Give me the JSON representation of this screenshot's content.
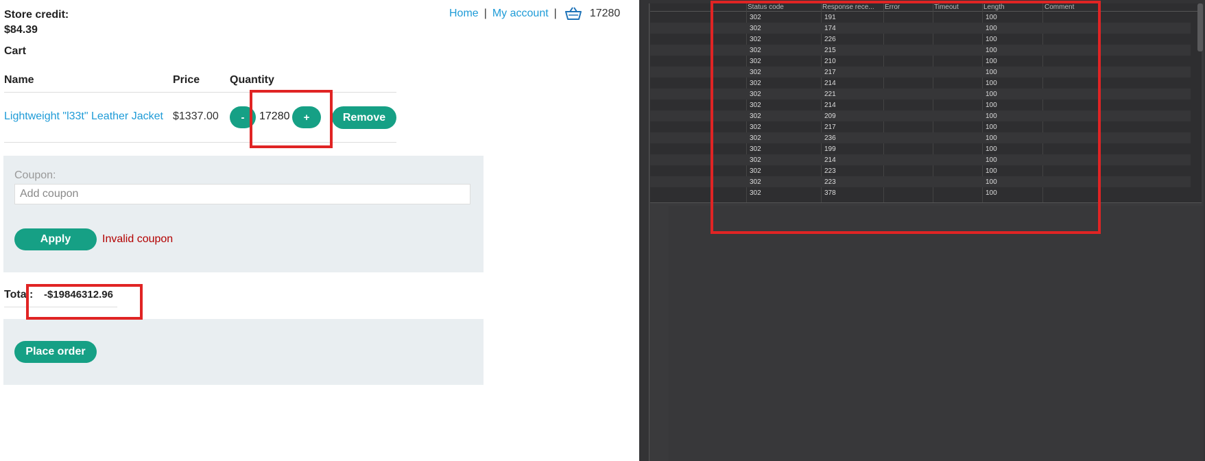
{
  "header": {
    "store_credit_label": "Store credit:",
    "store_credit_value": "$84.39",
    "nav_home": "Home",
    "nav_separator": "|",
    "nav_account": "My account",
    "cart_icon": "basket-icon",
    "cart_count": "17280"
  },
  "cart": {
    "title": "Cart",
    "columns": [
      "Name",
      "Price",
      "Quantity"
    ],
    "item": {
      "name": "Lightweight \"l33t\" Leather Jacket",
      "price": "$1337.00",
      "minus_label": "-",
      "quantity": "17280",
      "plus_label": "+",
      "remove_label": "Remove"
    }
  },
  "coupon": {
    "label": "Coupon:",
    "placeholder": "Add coupon",
    "apply_label": "Apply",
    "error": "Invalid coupon"
  },
  "total": {
    "label": "Total:",
    "value": "-$19846312.96"
  },
  "order": {
    "place_label": "Place order"
  },
  "results": {
    "columns": [
      "Status code",
      "Response rece...",
      "Error",
      "Timeout",
      "Length",
      "Comment"
    ],
    "rows": [
      {
        "status": "302",
        "response": "191",
        "length": "100"
      },
      {
        "status": "302",
        "response": "174",
        "length": "100"
      },
      {
        "status": "302",
        "response": "226",
        "length": "100"
      },
      {
        "status": "302",
        "response": "215",
        "length": "100"
      },
      {
        "status": "302",
        "response": "210",
        "length": "100"
      },
      {
        "status": "302",
        "response": "217",
        "length": "100"
      },
      {
        "status": "302",
        "response": "214",
        "length": "100"
      },
      {
        "status": "302",
        "response": "221",
        "length": "100"
      },
      {
        "status": "302",
        "response": "214",
        "length": "100"
      },
      {
        "status": "302",
        "response": "209",
        "length": "100"
      },
      {
        "status": "302",
        "response": "217",
        "length": "100"
      },
      {
        "status": "302",
        "response": "236",
        "length": "100"
      },
      {
        "status": "302",
        "response": "199",
        "length": "100"
      },
      {
        "status": "302",
        "response": "214",
        "length": "100"
      },
      {
        "status": "302",
        "response": "223",
        "length": "100"
      },
      {
        "status": "302",
        "response": "223",
        "length": "100"
      },
      {
        "status": "302",
        "response": "378",
        "length": "100"
      }
    ]
  },
  "colors": {
    "accent": "#16a085",
    "link": "#1e9bd7",
    "error": "#b30000",
    "highlight": "#e02424"
  }
}
